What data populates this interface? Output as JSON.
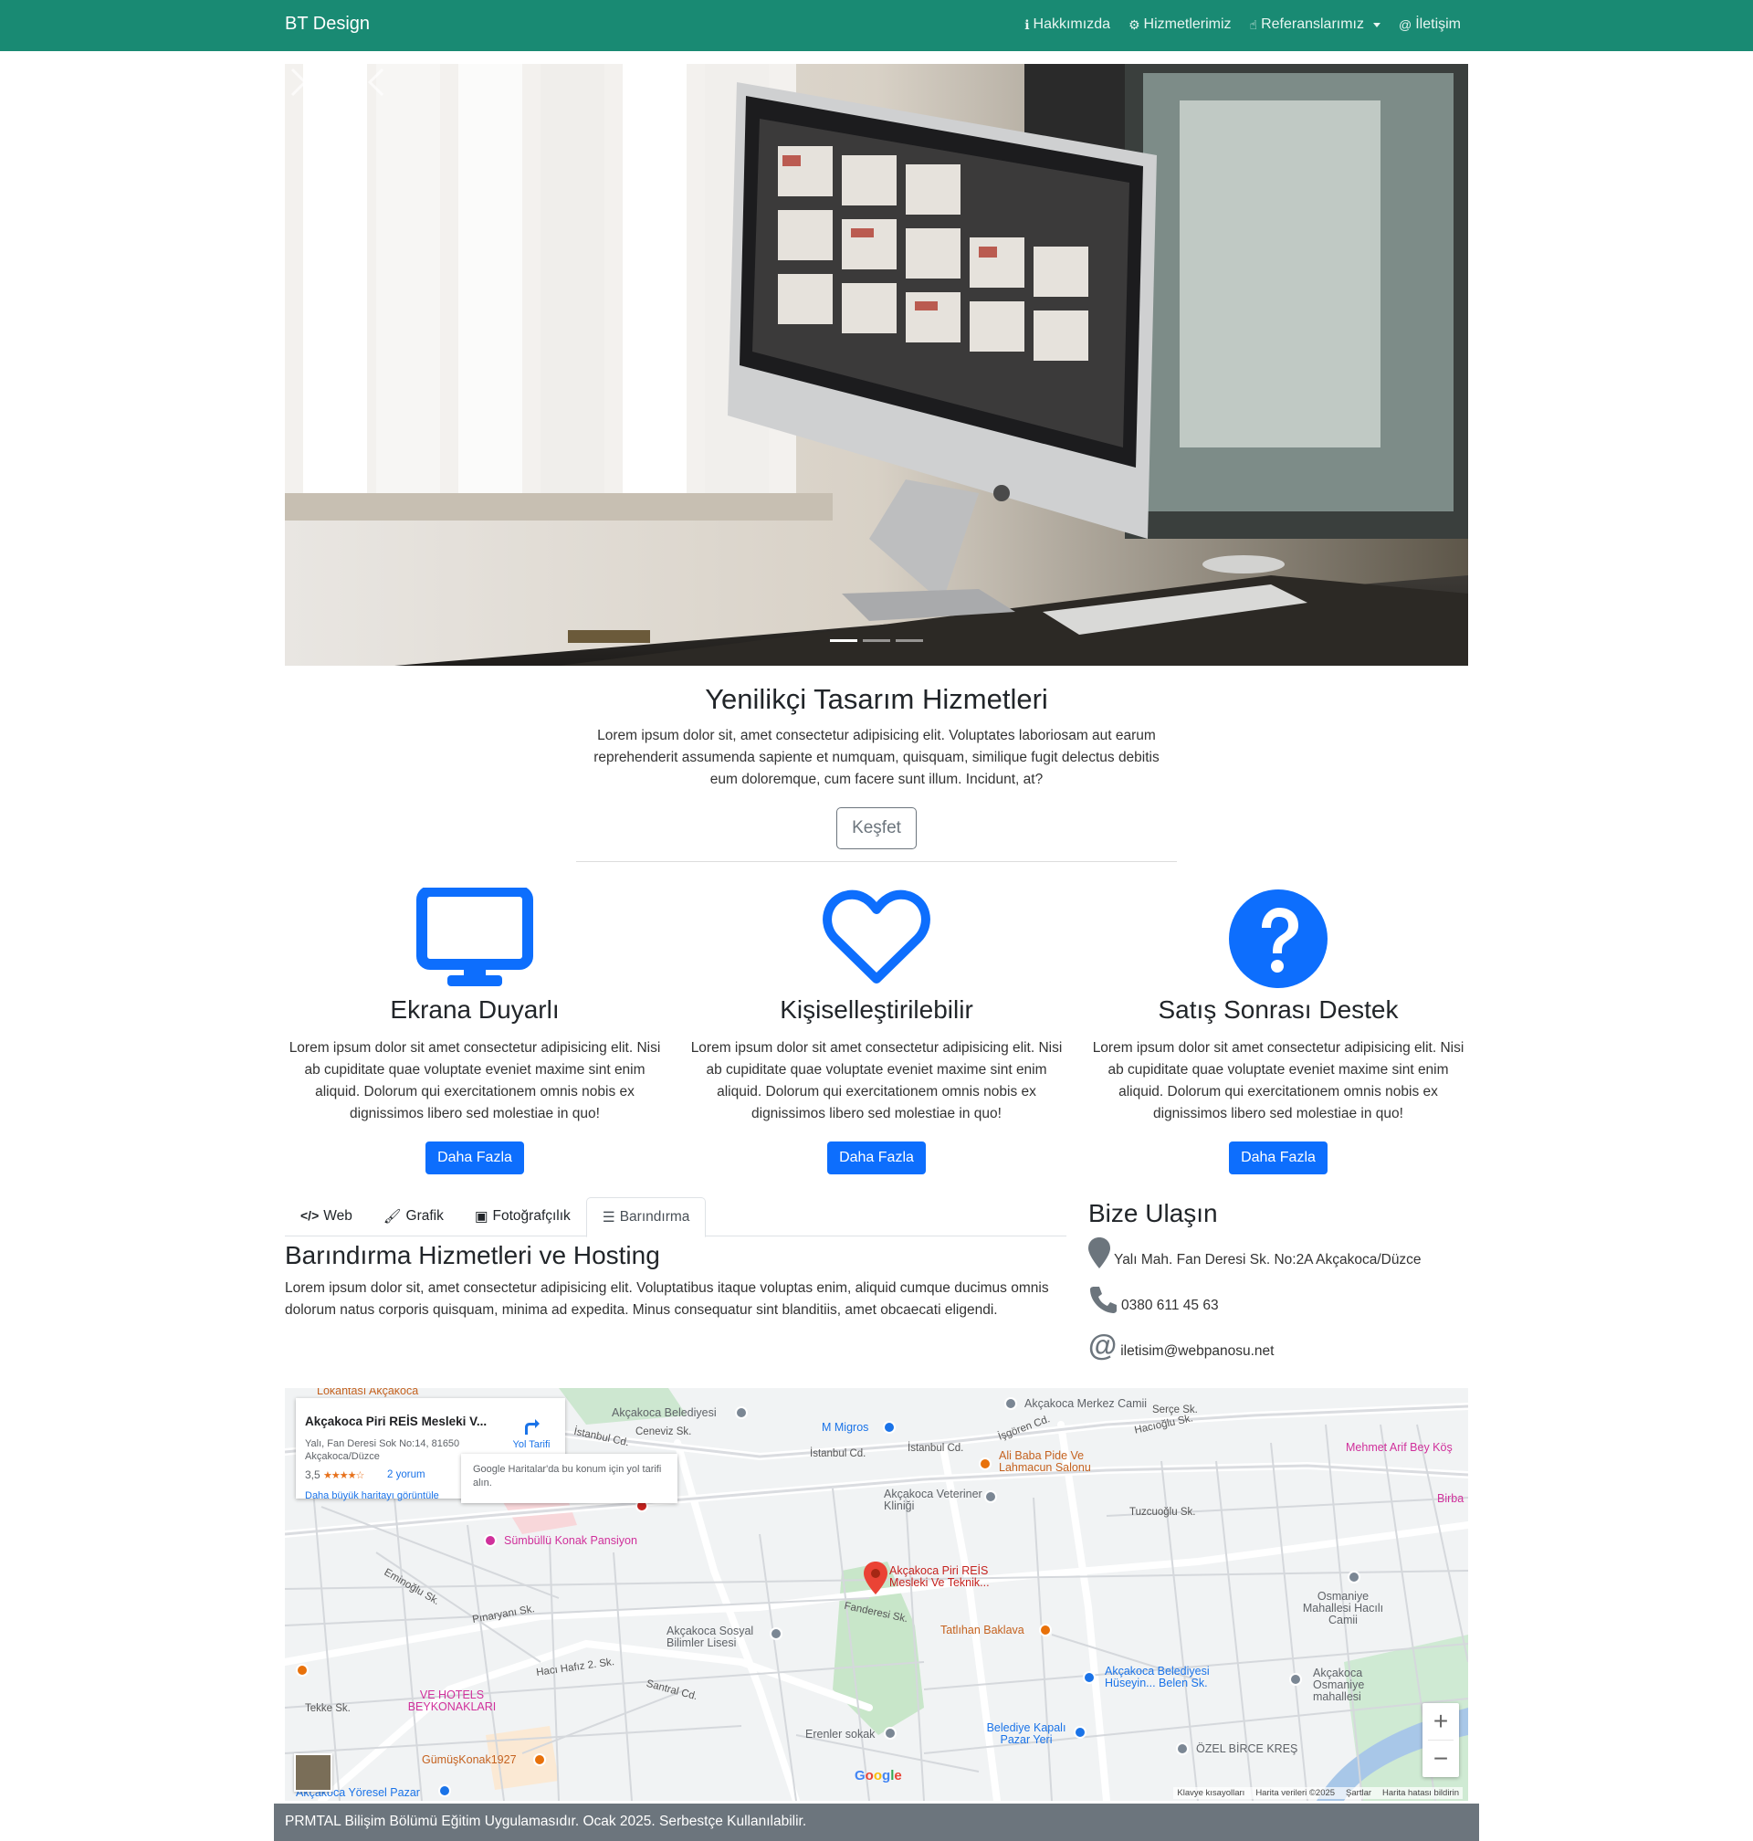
{
  "navbar": {
    "brand": "BT Design",
    "links": [
      {
        "label": "Hakkımızda",
        "icon": "info-icon"
      },
      {
        "label": "Hizmetlerimiz",
        "icon": "cogs-icon"
      },
      {
        "label": "Referanslarımız",
        "icon": "hand-icon"
      },
      {
        "label": "İletişim",
        "icon": "at-icon"
      }
    ],
    "color": "#198a73"
  },
  "carousel": {
    "slide_count": 3,
    "active_index": 0
  },
  "intro": {
    "title": "Yenilikçi Tasarım Hizmetleri",
    "text": "Lorem ipsum dolor sit, amet consectetur adipisicing elit. Voluptates laboriosam aut earum reprehenderit assumenda sapiente et numquam, quisquam, similique fugit delectus debitis eum doloremque, cum facere sunt illum. Incidunt, at?",
    "button": "Keşfet"
  },
  "features": [
    {
      "icon": "desktop-icon",
      "title": "Ekrana Duyarlı",
      "text": "Lorem ipsum dolor sit amet consectetur adipisicing elit. Nisi ab cupiditate quae voluptate eveniet maxime sint enim aliquid. Dolorum qui exercitationem omnis nobis ex dignissimos libero sed molestiae in quo!",
      "button": "Daha Fazla"
    },
    {
      "icon": "heart-icon",
      "title": "Kişiselleştirilebilir",
      "text": "Lorem ipsum dolor sit amet consectetur adipisicing elit. Nisi ab cupiditate quae voluptate eveniet maxime sint enim aliquid. Dolorum qui exercitationem omnis nobis ex dignissimos libero sed molestiae in quo!",
      "button": "Daha Fazla"
    },
    {
      "icon": "question-circle-icon",
      "title": "Satış Sonrası Destek",
      "text": "Lorem ipsum dolor sit amet consectetur adipisicing elit. Nisi ab cupiditate quae voluptate eveniet maxime sint enim aliquid. Dolorum qui exercitationem omnis nobis ex dignissimos libero sed molestiae in quo!",
      "button": "Daha Fazla"
    }
  ],
  "tabs": {
    "items": [
      {
        "label": "Web",
        "icon": "code-icon"
      },
      {
        "label": "Grafik",
        "icon": "brush-icon"
      },
      {
        "label": "Fotoğrafçılık",
        "icon": "image-icon"
      },
      {
        "label": "Barındırma",
        "icon": "server-icon"
      }
    ],
    "active": "Barındırma",
    "content_title": "Barındırma Hizmetleri ve Hosting",
    "content_text": "Lorem ipsum dolor sit, amet consectetur adipisicing elit. Voluptatibus itaque voluptas enim, aliquid cumque ducimus omnis dolorum natus corporis quisquam, minima ad expedita. Minus consequatur sint blanditiis, amet obcaecati eligendi."
  },
  "contact": {
    "title": "Bize Ulaşın",
    "address": "Yalı Mah. Fan Deresi Sk. No:2A Akçakoca/Düzce",
    "phone": "0380 611 45 63",
    "email": "iletisim@webpanosu.net"
  },
  "map": {
    "card": {
      "title": "Akçakoca Piri REİS Mesleki V...",
      "address": "Yalı, Fan Deresi Sok No:14, 81650 Akçakoca/Düzce",
      "rating": "3,5",
      "stars": "★★★★☆",
      "reviews": "2 yorum",
      "bigger_map": "Daha büyük haritayı görüntüle",
      "directions": "Yol Tarifi"
    },
    "tooltip": "Google Haritalar'da bu konum için yol tarifi alın.",
    "labels": {
      "belediye": "Akçakoca Belediyesi",
      "merkez_camii": "Akçakoca Merkez Camii",
      "migros": "M Migros",
      "ali_baba": "Ali Baba Pide Ve Lahmacun Salonu",
      "veteriner": "Akçakoca Veteriner Kliniği",
      "arif_bey": "Mehmet Arif Bey Köş",
      "birba": "Birba",
      "sumbullu": "Sümbüllü Konak Pansiyon",
      "piri_reis": "Akçakoca Piri REİS Mesleki Ve Teknik...",
      "tatlihan": "Tatlıhan Baklava",
      "sosyal": "Akçakoca Sosyal Bilimler Lisesi",
      "ve_hotels": "VE HOTELS BEYKONAKLARI",
      "gumus": "GümüşKonak1927",
      "pazar": "Akçakoca Yöresel Pazar",
      "erenler": "Erenler sokak",
      "belediye_kapali": "Belediye Kapalı Pazar Yeri",
      "belediye_huseyin": "Akçakoca Belediyesi Hüseyin... Belen Sk.",
      "osmaniye_camii": "Osmaniye Mahallesi Hacılı Camii",
      "osmaniye_mah": "Akçakoca Osmaniye mahallesi",
      "birce": "ÖZEL BİRCE KREŞ",
      "lokantasi": "Lokantası Akçakoca",
      "istanbul_cd": "İstanbul Cd.",
      "ceneviz": "Ceneviz Sk.",
      "isgoren": "İşgören Cd.",
      "tuzcuoglu": "Tuzcuoğlu Sk.",
      "fanderesi": "Fanderesi Sk.",
      "santral": "Santral Cd.",
      "haci_hafiz": "Hacı Hafız 2. Sk.",
      "tekke": "Tekke Sk.",
      "pinaryani": "Pınaryanı Sk.",
      "eminoglu": "Eminoğlu Sk.",
      "serce": "Serçe Sk.",
      "hacioglu": "Hacıoğlu Sk."
    },
    "attribution": [
      "Klavye kısayolları",
      "Harita verileri ©2025",
      "Şartlar",
      "Harita hatası bildirin"
    ],
    "brand": "Google"
  },
  "footer": {
    "text": "PRMTAL Bilişim Bölümü Eğitim Uygulamasıdır. Ocak 2025. Serbestçe Kullanılabilir."
  }
}
